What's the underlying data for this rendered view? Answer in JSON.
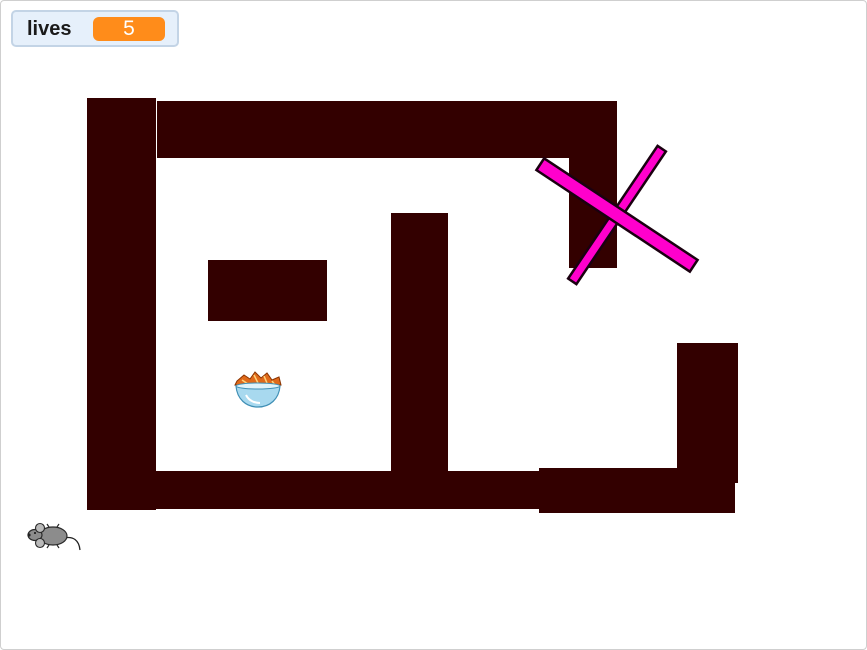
{
  "monitor": {
    "label": "lives",
    "value": "5"
  },
  "colors": {
    "wall": "#330000",
    "spinner": "#ff00cc",
    "monitor_value_bg": "#ff8c1a"
  },
  "sprites": {
    "player": "mouse-icon",
    "goal": "food-bowl-icon",
    "obstacle": "rotating-cross-spinner"
  }
}
